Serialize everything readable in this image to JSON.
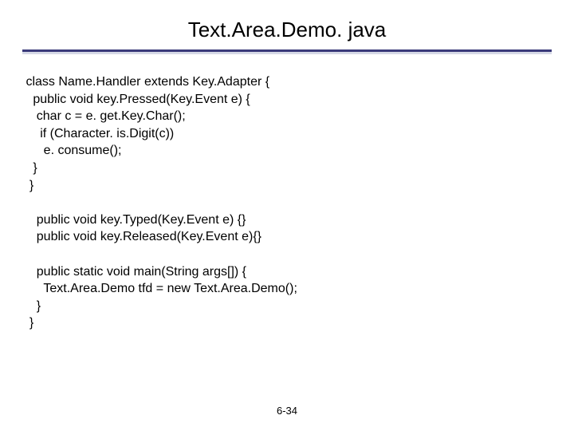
{
  "title": "Text.Area.Demo. java",
  "code_lines": [
    " class Name.Handler extends Key.Adapter {",
    "   public void key.Pressed(Key.Event e) {",
    "    char c = e. get.Key.Char();",
    "     if (Character. is.Digit(c))",
    "      e. consume();",
    "   }",
    "  }",
    "",
    "    public void key.Typed(Key.Event e) {}",
    "    public void key.Released(Key.Event e){}",
    "",
    "    public static void main(String args[]) {",
    "      Text.Area.Demo tfd = new Text.Area.Demo();",
    "    }",
    "  }"
  ],
  "page_number": "6-34"
}
